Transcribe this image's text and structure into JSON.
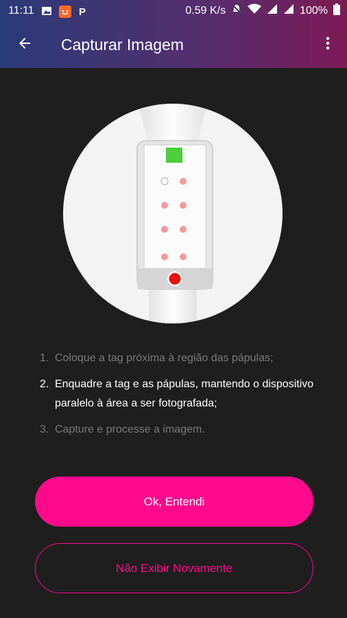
{
  "status_bar": {
    "time": "11:11",
    "speed": "0.59 K/s",
    "battery": "100%",
    "icons": [
      "image-icon",
      "app-notification-icon",
      "parking-icon",
      "mute-icon",
      "wifi-icon",
      "signal-icon",
      "signal-icon",
      "battery-icon"
    ]
  },
  "app_bar": {
    "title": "Capturar Imagem",
    "back_icon": "arrow-left-icon",
    "menu_icon": "more-vertical-icon",
    "gradient": [
      "#2b3a78",
      "#7d1b55"
    ]
  },
  "instructions": {
    "steps": [
      {
        "number": "1.",
        "text": "Coloque a tag próxima à região das pápulas;"
      },
      {
        "number": "2.",
        "text": "Enquadre a tag e as pápulas, mantendo o dispositivo paralelo à área a ser fotografada;"
      },
      {
        "number": "3.",
        "text": "Capture e processe a imagem."
      }
    ],
    "active_step": 2
  },
  "buttons": {
    "primary_label": "Ok, Entendi",
    "secondary_label": "Não Exibir Novamente"
  },
  "colors": {
    "accent": "#ff0a8c",
    "background": "#1f1e1e",
    "dim_text": "#7a7a7a"
  }
}
